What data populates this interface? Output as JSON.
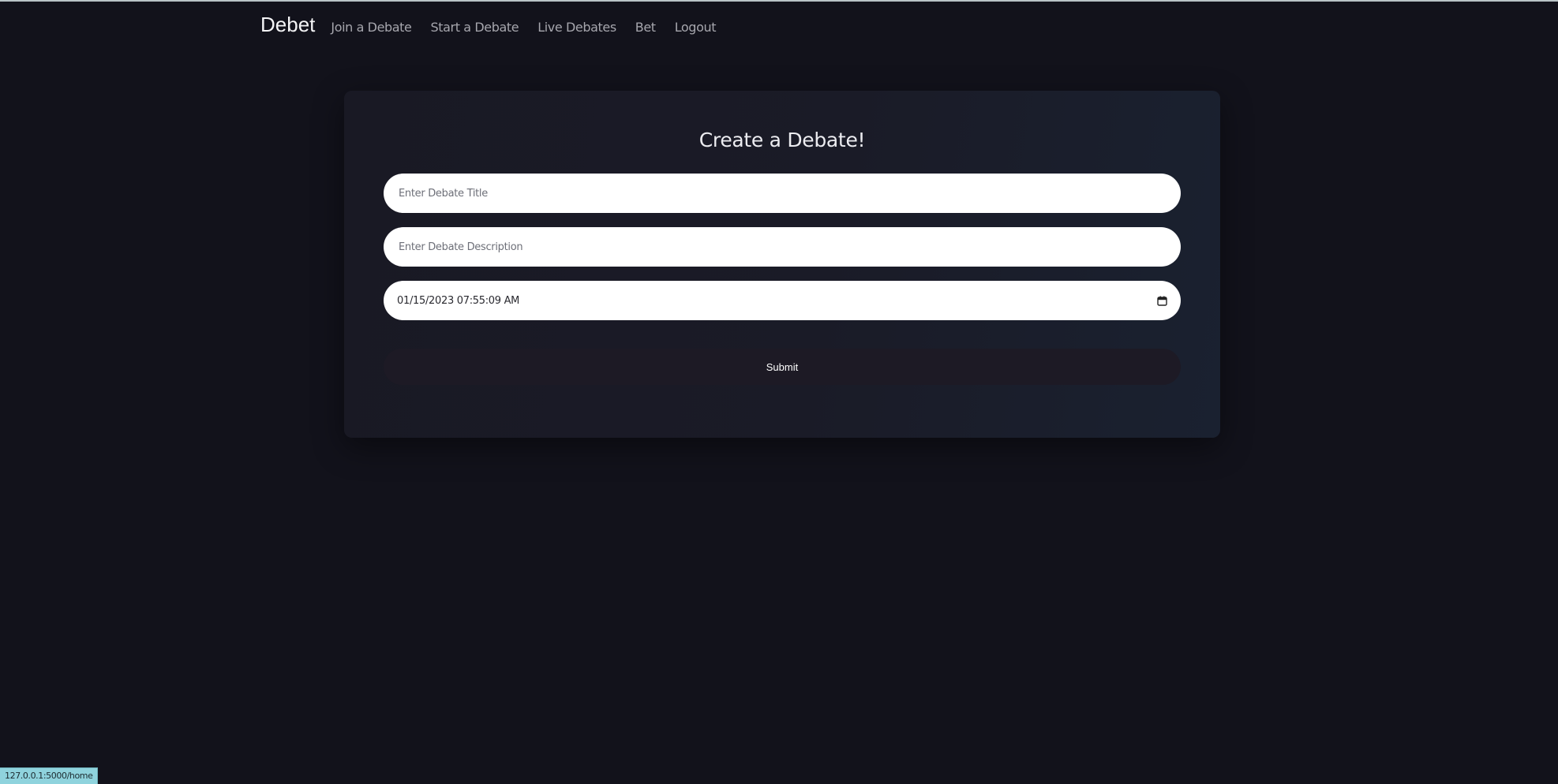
{
  "navbar": {
    "brand": "Debet",
    "links": [
      {
        "label": "Join a Debate"
      },
      {
        "label": "Start a Debate"
      },
      {
        "label": "Live Debates"
      },
      {
        "label": "Bet"
      },
      {
        "label": "Logout"
      }
    ]
  },
  "form": {
    "title": "Create a Debate!",
    "debate_title": {
      "placeholder": "Enter Debate Title",
      "value": ""
    },
    "debate_description": {
      "placeholder": "Enter Debate Description",
      "value": ""
    },
    "datetime": {
      "value": "01/15/2023 07:55:09  AM",
      "icon": "calendar-icon"
    },
    "submit_label": "Submit"
  },
  "status_bar": {
    "url": "127.0.0.1:5000/home"
  },
  "colors": {
    "background": "#12121b",
    "card": "#1a1b27",
    "field": "#ffffff",
    "submit": "#1d1a25",
    "status_bar": "#8fd3dd"
  }
}
